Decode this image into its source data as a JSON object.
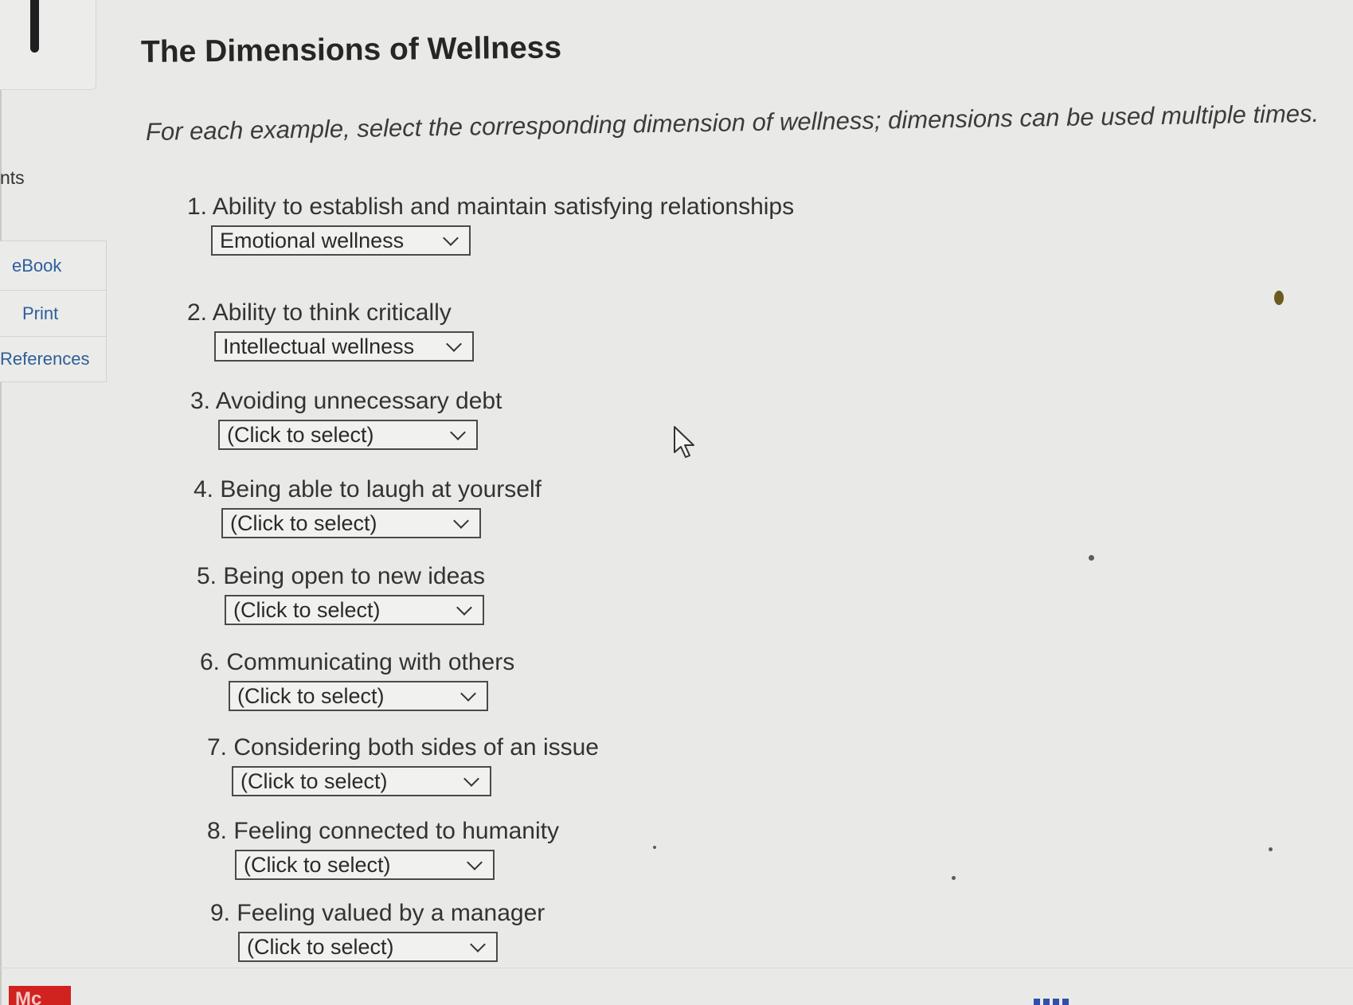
{
  "sidebar": {
    "heading": "nts",
    "tabs": [
      {
        "label": "eBook"
      },
      {
        "label": "Print"
      },
      {
        "label": "References"
      }
    ],
    "badge": "Mc"
  },
  "main": {
    "title": "The Dimensions of Wellness",
    "instruction": "For each example, select the corresponding dimension of wellness; dimensions can be used multiple times.",
    "questions": [
      {
        "number": "1.",
        "text": "Ability to establish and maintain satisfying relationships",
        "selected": "Emotional wellness"
      },
      {
        "number": "2.",
        "text": "Ability to think critically",
        "selected": "Intellectual wellness"
      },
      {
        "number": "3.",
        "text": "Avoiding unnecessary debt",
        "selected": "(Click to select)"
      },
      {
        "number": "4.",
        "text": "Being able to laugh at yourself",
        "selected": "(Click to select)"
      },
      {
        "number": "5.",
        "text": "Being open to new ideas",
        "selected": "(Click to select)"
      },
      {
        "number": "6.",
        "text": "Communicating with others",
        "selected": "(Click to select)"
      },
      {
        "number": "7.",
        "text": "Considering both sides of an issue",
        "selected": "(Click to select)"
      },
      {
        "number": "8.",
        "text": "Feeling connected to humanity",
        "selected": "(Click to select)"
      },
      {
        "number": "9.",
        "text": "Feeling valued by a manager",
        "selected": "(Click to select)"
      }
    ]
  },
  "colors": {
    "background": "#e9e9e7",
    "link": "#2e5e9a",
    "brand_badge": "#d0221e"
  }
}
